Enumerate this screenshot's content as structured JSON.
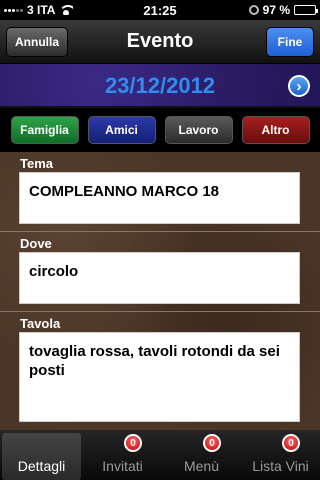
{
  "status_bar": {
    "carrier": "3 ITA",
    "time": "21:25",
    "battery": "97 %",
    "battery_level": 0.97
  },
  "nav": {
    "cancel_label": "Annulla",
    "title": "Evento",
    "done_label": "Fine"
  },
  "date_bar": {
    "date": "23/12/2012",
    "next_icon": "chevron-right-circle-icon"
  },
  "categories": [
    {
      "label": "Famiglia",
      "color": "#1f8a3a"
    },
    {
      "label": "Amici",
      "color": "#1a2a8c"
    },
    {
      "label": "Lavoro",
      "color": "#3e3e3e"
    },
    {
      "label": "Altro",
      "color": "#8a1414"
    }
  ],
  "form": {
    "tema": {
      "label": "Tema",
      "value": "COMPLEANNO MARCO 18"
    },
    "dove": {
      "label": "Dove",
      "value": "circolo"
    },
    "tavola": {
      "label": "Tavola",
      "value": "tovaglia rossa, tavoli rotondi da sei posti"
    }
  },
  "tabs": [
    {
      "label": "Dettagli",
      "badge": ""
    },
    {
      "label": "Invitati",
      "badge": "0"
    },
    {
      "label": "Menù",
      "badge": "0"
    },
    {
      "label": "Lista Vini",
      "badge": "0"
    }
  ]
}
